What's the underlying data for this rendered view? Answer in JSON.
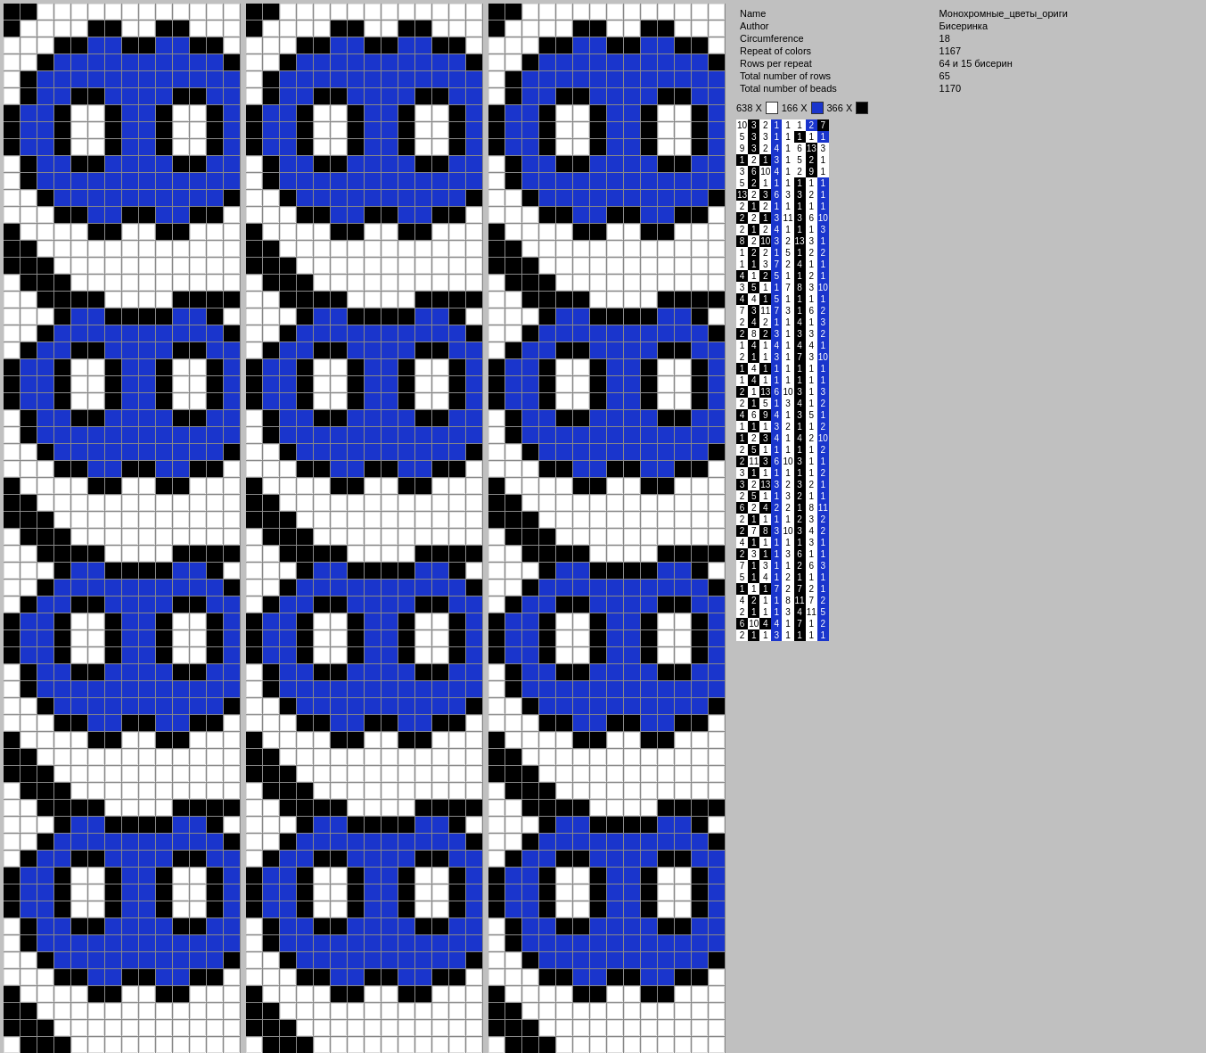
{
  "info": {
    "name_label": "Name",
    "name_value": "Монохромные_цветы_ориги",
    "author_label": "Author",
    "author_value": "Бисеринка",
    "circumference_label": "Circumference",
    "circumference_value": "18",
    "repeat_colors_label": "Repeat of colors",
    "repeat_colors_value": "1167",
    "rows_per_repeat_label": "Rows per repeat",
    "rows_per_repeat_value": "64 и 15 бисерин",
    "total_rows_label": "Total number of rows",
    "total_rows_value": "65",
    "total_beads_label": "Total number of beads",
    "total_beads_value": "1170",
    "color1_count": "638 X",
    "color2_count": "166 X",
    "color3_count": "366 X"
  },
  "colors": {
    "black": "#000000",
    "white": "#ffffff",
    "blue": "#1a35cc"
  }
}
